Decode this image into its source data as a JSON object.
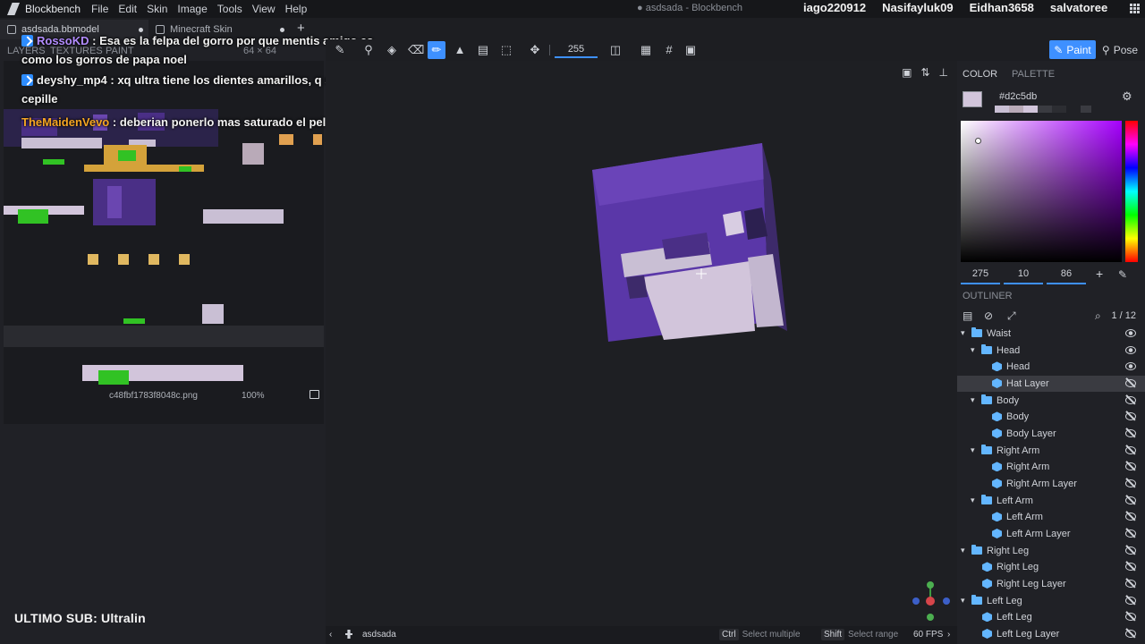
{
  "titlebar": {
    "app_name": "Blockbench",
    "menus": [
      "File",
      "Edit",
      "Skin",
      "Image",
      "Tools",
      "View",
      "Help"
    ],
    "window_title": "● asdsada - Blockbench",
    "viewers": [
      "iago220912",
      "Nasifayluk09",
      "Eidhan3658",
      "salvatoree"
    ]
  },
  "tabs": [
    {
      "label": "asdsada.bbmodel",
      "active": true
    },
    {
      "label": "Minecraft Skin",
      "active": false
    }
  ],
  "left_panel": {
    "headers": [
      "LAYERS",
      "TEXTURES",
      "PAINT"
    ],
    "texture_size": "64 × 64",
    "texture_file": "c48fbf1783f8048c.png",
    "zoom": "100%"
  },
  "chat": [
    {
      "user": "RossoKD",
      "user_color": "#b38cff",
      "badge": true,
      "text": ": Esa es la felpa del gorro por que mentis amigo es como los gorros de papa noel"
    },
    {
      "user": "deyshy_mp4",
      "user_color": "#cfd2d8",
      "badge": true,
      "text": ": xq ultra tiene los dientes amarillos, q se los cepille"
    },
    {
      "user": "TheMaidenVevo",
      "user_color": "#f5a623",
      "badge": false,
      "text": ": deberian ponerlo mas saturado el pelo talves"
    }
  ],
  "stream_overlay": {
    "ultimo_sub": "ULTIMO SUB: Ultralin"
  },
  "toolbar": {
    "brush_size": "255",
    "mode_paint": "Paint",
    "mode_pose": "Pose"
  },
  "color_panel": {
    "tabs": [
      "COLOR",
      "PALETTE"
    ],
    "current_color": "#d2c5db",
    "hex_label": "#d2c5db",
    "hue": "275",
    "saturation": "10",
    "value": "86"
  },
  "outliner": {
    "title": "OUTLINER",
    "count": "1 / 12",
    "rows": [
      {
        "label": "Waist",
        "type": "group",
        "level": 0,
        "visible": true
      },
      {
        "label": "Head",
        "type": "group",
        "level": 1,
        "visible": true
      },
      {
        "label": "Head",
        "type": "cube",
        "level": 2,
        "visible": true
      },
      {
        "label": "Hat Layer",
        "type": "cube",
        "level": 2,
        "visible": false,
        "selected": true
      },
      {
        "label": "Body",
        "type": "group",
        "level": 1,
        "visible": false
      },
      {
        "label": "Body",
        "type": "cube",
        "level": 2,
        "visible": false
      },
      {
        "label": "Body Layer",
        "type": "cube",
        "level": 2,
        "visible": false
      },
      {
        "label": "Right Arm",
        "type": "group",
        "level": 1,
        "visible": false
      },
      {
        "label": "Right Arm",
        "type": "cube",
        "level": 2,
        "visible": false
      },
      {
        "label": "Right Arm Layer",
        "type": "cube",
        "level": 2,
        "visible": false
      },
      {
        "label": "Left Arm",
        "type": "group",
        "level": 1,
        "visible": false
      },
      {
        "label": "Left Arm",
        "type": "cube",
        "level": 2,
        "visible": false
      },
      {
        "label": "Left Arm Layer",
        "type": "cube",
        "level": 2,
        "visible": false
      },
      {
        "label": "Right Leg",
        "type": "group",
        "level": 0,
        "visible": false
      },
      {
        "label": "Right Leg",
        "type": "cube",
        "level": 1,
        "visible": false
      },
      {
        "label": "Right Leg Layer",
        "type": "cube",
        "level": 1,
        "visible": false
      },
      {
        "label": "Left Leg",
        "type": "group",
        "level": 0,
        "visible": false
      },
      {
        "label": "Left Leg",
        "type": "cube",
        "level": 1,
        "visible": false
      },
      {
        "label": "Left Leg Layer",
        "type": "cube",
        "level": 1,
        "visible": false
      }
    ]
  },
  "statusbar": {
    "model_name": "asdsada",
    "ctrl_key": "Ctrl",
    "ctrl_hint": "Select multiple",
    "shift_key": "Shift",
    "shift_hint": "Select range",
    "fps": "60 FPS"
  }
}
